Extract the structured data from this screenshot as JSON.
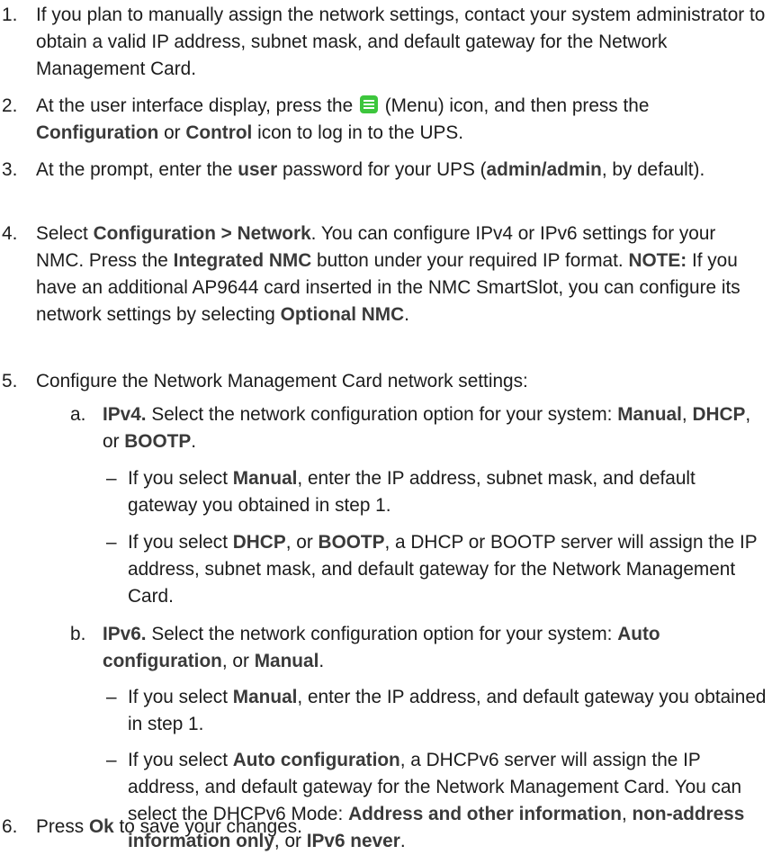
{
  "steps": [
    {
      "num": "1.",
      "text": "If you plan to manually assign the network settings, contact your system administrator to obtain a valid IP address, subnet mask, and default gateway for the Network Management Card."
    },
    {
      "num": "2.",
      "t1": "At the user interface display, press the",
      "t2": "(Menu) icon, and then press the",
      "b1": "Configuration",
      "t3": "or",
      "b2": "Control",
      "t4": "icon to log in to the UPS.",
      "icon": "menu-icon",
      "icon_color": "#3dc63d"
    },
    {
      "num": "3.",
      "t1": "At the prompt, enter the",
      "b1": "user",
      "t2": "password for your UPS (",
      "b2": "admin/admin",
      "t3": ", by default)."
    },
    {
      "num": "4.",
      "t1": "Select",
      "b1": "Configuration > Network",
      "t2": ". You can configure IPv4 or IPv6 settings for your NMC. Press the",
      "b2": "Integrated NMC",
      "t3": "button under your required IP format.",
      "b3": "NOTE:",
      "t4": "If you have an additional AP9644 card inserted in the NMC SmartSlot, you can configure its network settings by selecting",
      "b4": "Optional NMC",
      "t5": "."
    },
    {
      "num": "5.",
      "text": "Configure the Network Management Card network settings:"
    },
    {
      "num": "6.",
      "t1": "Press",
      "b1": "Ok",
      "t2": "to save your changes."
    }
  ],
  "sub_a": {
    "num": "a.",
    "b1": "IPv4.",
    "t1": "Select the network configuration option for your system:",
    "b2": "Manual",
    "t2": ",",
    "b3": "DHCP",
    "t3": ", or",
    "b4": "BOOTP",
    "t4": ".",
    "items": [
      {
        "dash": "–",
        "t1": "If you select",
        "b1": "Manual",
        "t2": ", enter the IP address, subnet mask, and default gateway you obtained in step 1."
      },
      {
        "dash": "–",
        "t1": "If you select",
        "b1": "DHCP",
        "t2": ", or",
        "b2": "BOOTP",
        "t3": ", a DHCP or BOOTP server will assign the IP address, subnet mask, and default gateway for the Network Management Card."
      }
    ]
  },
  "sub_b": {
    "num": "b.",
    "b1": "IPv6.",
    "t1": "Select the network configuration option for your system:",
    "b2": "Auto configuration",
    "t2": ", or",
    "b3": "Manual",
    "t3": ".",
    "items": [
      {
        "dash": "–",
        "t1": "If you select",
        "b1": "Manual",
        "t2": ", enter the IP address, and default gateway you obtained in step 1."
      },
      {
        "dash": "–",
        "t1": "If you select",
        "b1": "Auto configuration",
        "t2": ", a DHCPv6 server will assign the IP address, and default gateway for the Network Management Card. You can select the DHCPv6 Mode:",
        "b2": "Address and other information",
        "t3": ",",
        "b3": "non-address information only",
        "t4": ", or",
        "b4": "IPv6 never",
        "t5": "."
      }
    ]
  }
}
